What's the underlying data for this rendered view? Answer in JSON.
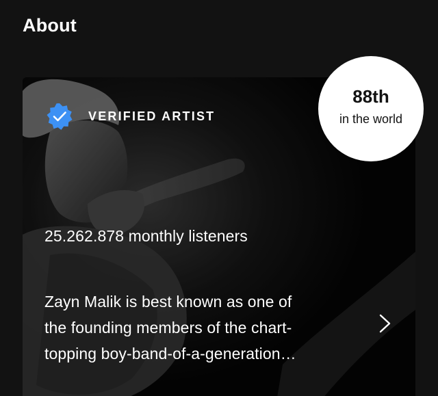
{
  "section": {
    "title": "About"
  },
  "card": {
    "verified_label": "VERIFIED ARTIST",
    "verified_icon": "verified-badge-icon",
    "rank": {
      "value": "88th",
      "caption": "in the world"
    },
    "monthly_listeners": "25.262.878 monthly listeners",
    "bio_lines": [
      "Zayn Malik is best known as one of",
      "the founding members of the chart-",
      "topping boy-band-of-a-generation…"
    ],
    "chevron_icon": "chevron-right-icon"
  },
  "colors": {
    "background": "#121212",
    "card": "#050505",
    "verified_blue": "#3d91f4",
    "badge": "#ffffff",
    "text": "#ffffff"
  }
}
